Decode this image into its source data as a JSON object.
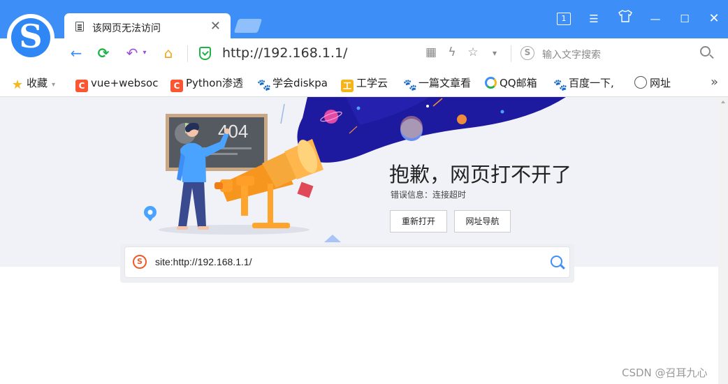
{
  "browser": {
    "tab": {
      "title": "该网页无法访问",
      "close": "✕"
    },
    "window_controls": {
      "tab_count": "1",
      "menu": "☰",
      "skin": "👕",
      "minimize": "—",
      "maximize": "☐",
      "close": "✕"
    }
  },
  "navbar": {
    "back": "←",
    "reload": "⟳",
    "undo": "↶",
    "undo_dropdown": "▾",
    "home": "⌂",
    "url": "http://192.168.1.1/",
    "tools": {
      "qr": "▦",
      "lightning": "ϟ",
      "star": "☆",
      "dropdown": "▾"
    },
    "search_engine_letter": "S",
    "search_placeholder": "输入文字搜索"
  },
  "bookmarks": {
    "items": [
      {
        "label": "收藏",
        "icon": "star-icon",
        "glyph": "★"
      },
      {
        "label": "vue+websoc",
        "icon": "csdn-icon",
        "glyph": "C"
      },
      {
        "label": "Python渗透",
        "icon": "csdn-icon",
        "glyph": "C"
      },
      {
        "label": "学会diskpa",
        "icon": "baidu-paw-icon",
        "glyph": "🐾"
      },
      {
        "label": "工学云",
        "icon": "gongxueyun-icon",
        "glyph": "工"
      },
      {
        "label": "一篇文章看",
        "icon": "baidu-paw-icon",
        "glyph": "🐾"
      },
      {
        "label": "QQ邮箱",
        "icon": "qq-mail-icon",
        "glyph": ""
      },
      {
        "label": "百度一下,",
        "icon": "baidu-paw-icon",
        "glyph": "🐾"
      },
      {
        "label": "网址",
        "icon": "globe-icon",
        "glyph": "⊕"
      }
    ],
    "more": "»",
    "dropdown": "▾"
  },
  "error_page": {
    "illustration_code": "404",
    "title": "抱歉，网页打不开了",
    "message": "错误信息：连接超时",
    "reopen_button": "重新打开",
    "nav_button": "网址导航",
    "site_search_query": "site:http://192.168.1.1/",
    "site_search_logo": "S"
  },
  "watermark": "CSDN @召耳九心",
  "colors": {
    "accent": "#3d8ff7",
    "success": "#20b34a",
    "hero_bg": "#f0f2f7",
    "space": "#1e1aa0"
  }
}
